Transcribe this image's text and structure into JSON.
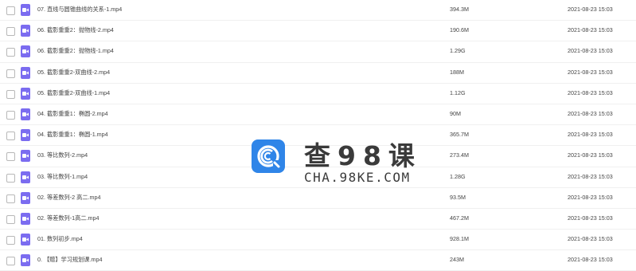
{
  "files": [
    {
      "name": "07. 直线与圆锥曲线的关系-1.mp4",
      "size": "394.3M",
      "date": "2021-08-23 15:03"
    },
    {
      "name": "06. 截影重重2：抛物线-2.mp4",
      "size": "190.6M",
      "date": "2021-08-23 15:03"
    },
    {
      "name": "06. 截影重重2：抛物线-1.mp4",
      "size": "1.29G",
      "date": "2021-08-23 15:03"
    },
    {
      "name": "05. 截影重重2-双曲线-2.mp4",
      "size": "188M",
      "date": "2021-08-23 15:03"
    },
    {
      "name": "05. 截影重重2-双曲线-1.mp4",
      "size": "1.12G",
      "date": "2021-08-23 15:03"
    },
    {
      "name": "04. 截影重重1：椭圆-2.mp4",
      "size": "90M",
      "date": "2021-08-23 15:03"
    },
    {
      "name": "04. 截影重重1：椭圆-1.mp4",
      "size": "365.7M",
      "date": "2021-08-23 15:03"
    },
    {
      "name": "03. 等比数列-2.mp4",
      "size": "273.4M",
      "date": "2021-08-23 15:03"
    },
    {
      "name": "03. 等比数列-1.mp4",
      "size": "1.28G",
      "date": "2021-08-23 15:03"
    },
    {
      "name": "02. 等差数列-2 高二.mp4",
      "size": "93.5M",
      "date": "2021-08-23 15:03"
    },
    {
      "name": "02. 等差数列-1高二.mp4",
      "size": "467.2M",
      "date": "2021-08-23 15:03"
    },
    {
      "name": "01. 数列初步.mp4",
      "size": "928.1M",
      "date": "2021-08-23 15:03"
    },
    {
      "name": "0. 【赠】学习规划课.mp4",
      "size": "243M",
      "date": "2021-08-23 15:03"
    }
  ],
  "icons": {
    "file": "video-file-icon",
    "checkbox": "checkbox-icon",
    "logo": "cha98ke-logo-icon"
  },
  "colors": {
    "file_icon": "#7b6cf0",
    "logo": "#2f85e8"
  },
  "watermark": {
    "title": "查98课",
    "subtitle": "CHA.98KE.COM"
  }
}
